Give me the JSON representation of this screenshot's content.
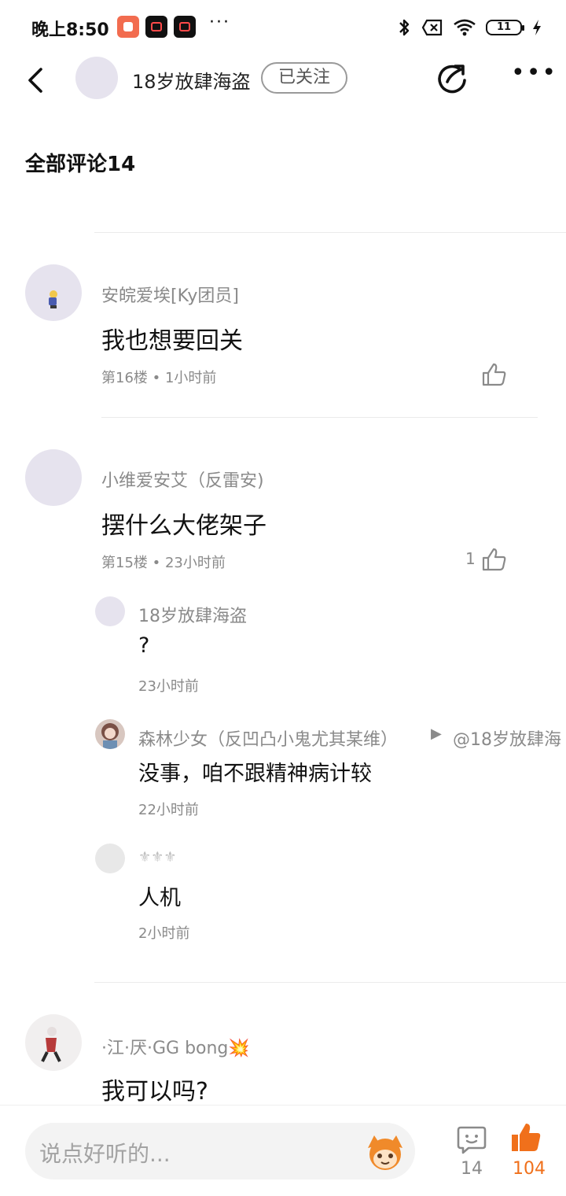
{
  "status_bar": {
    "time": "晚上8:50",
    "more": "···",
    "battery": "11"
  },
  "header": {
    "user_name": "18岁放肆海盗",
    "follow_label": "已关注",
    "more": "•••"
  },
  "section_title": "全部评论14",
  "comments": [
    {
      "name": "安皖爱埃[Ky团员]",
      "text": "我也想要回关",
      "meta": "第16楼 • 1小时前",
      "likes": ""
    },
    {
      "name": "小维爱安艾（反雷安)",
      "text": "摆什么大佬架子",
      "meta": "第15楼 • 23小时前",
      "likes": "1",
      "replies": [
        {
          "name": "18岁放肆海盗",
          "text": "?",
          "meta": "23小时前"
        },
        {
          "name": "森林少女（反凹凸小鬼尤其某维）",
          "arrow": "▶",
          "reply_to": "@18岁放肆海",
          "text": "没事，咱不跟精神病计较",
          "meta": "22小时前"
        },
        {
          "name": "⚜⚜⚜",
          "text": "人机",
          "meta": "2小时前"
        }
      ]
    },
    {
      "name": "·江·厌·GG bong💥",
      "text": "我可以吗?"
    }
  ],
  "bottom": {
    "input_placeholder": "说点好听的...",
    "comment_count": "14",
    "like_count": "104"
  },
  "colors": {
    "accent": "#f0701b",
    "avatar_bg": "#e6e3ee"
  }
}
